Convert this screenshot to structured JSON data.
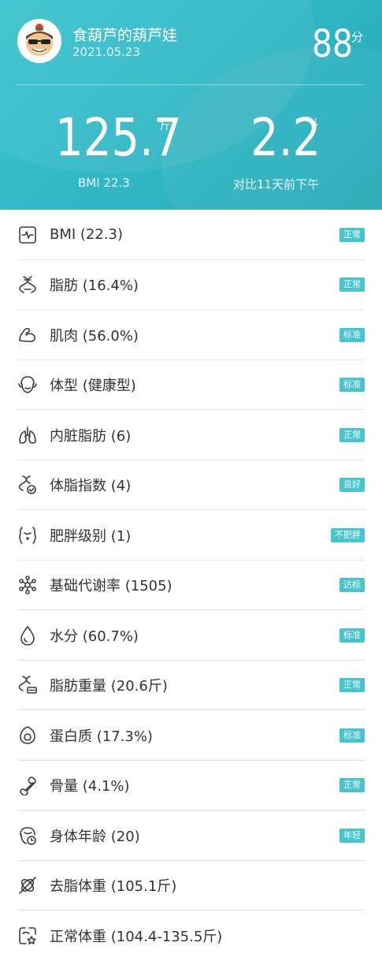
{
  "theme": {
    "accent": "#45c6cf",
    "header_bg": "#35b9c7"
  },
  "profile": {
    "username": "食葫芦的葫芦娃",
    "date": "2021.05.23",
    "score": "88",
    "score_unit": "分"
  },
  "summary": {
    "weight": "125.7",
    "weight_unit": "斤",
    "bmi_label": "BMI 22.3",
    "diff": "2.2",
    "diff_arrow": "↓",
    "diff_label": "对比11天前下午"
  },
  "metrics": [
    {
      "icon": "heart-rate-monitor-icon",
      "label": "BMI (22.3)",
      "badge": "正常"
    },
    {
      "icon": "dna-icon",
      "label": "脂肪 (16.4%)",
      "badge": "正常"
    },
    {
      "icon": "muscle-arm-icon",
      "label": "肌肉 (56.0%)",
      "badge": "标准"
    },
    {
      "icon": "face-icon",
      "label": "体型 (健康型)",
      "badge": "标准"
    },
    {
      "icon": "lungs-icon",
      "label": "内脏脂肪 (6)",
      "badge": "正常"
    },
    {
      "icon": "dna-check-icon",
      "label": "体脂指数 (4)",
      "badge": "良好"
    },
    {
      "icon": "body-outline-icon",
      "label": "肥胖级别 (1)",
      "badge": "不肥胖"
    },
    {
      "icon": "molecule-icon",
      "label": "基础代谢率 (1505)",
      "badge": "达标"
    },
    {
      "icon": "water-drop-icon",
      "label": "水分 (60.7%)",
      "badge": "标准"
    },
    {
      "icon": "dna-weight-icon",
      "label": "脂肪重量 (20.6斤)",
      "badge": "正常"
    },
    {
      "icon": "egg-icon",
      "label": "蛋白质 (17.3%)",
      "badge": "标准"
    },
    {
      "icon": "bone-icon",
      "label": "骨量 (4.1%)",
      "badge": "正常"
    },
    {
      "icon": "face-clock-icon",
      "label": "身体年龄 (20)",
      "badge": "年轻"
    },
    {
      "icon": "lean-mass-icon",
      "label": "去脂体重 (105.1斤)",
      "badge": ""
    },
    {
      "icon": "scale-star-icon",
      "label": "正常体重 (104.4-135.5斤)",
      "badge": ""
    }
  ]
}
